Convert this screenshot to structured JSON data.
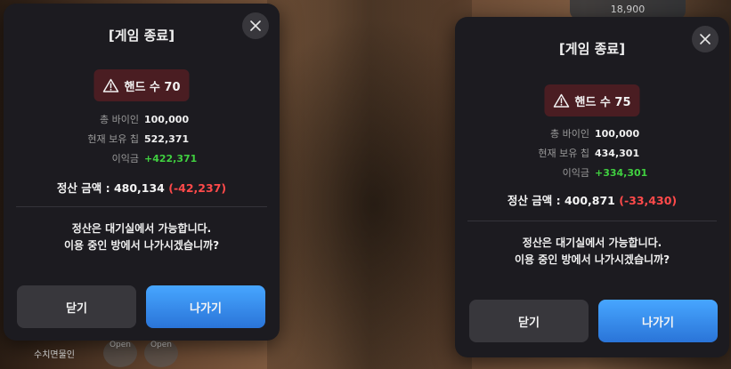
{
  "background": {
    "score": "18,900",
    "open_label": "Open",
    "player_name": "수치면물인"
  },
  "modals": [
    {
      "title": "[게임 종료]",
      "hands_label": "핸드 수 70",
      "stats": [
        {
          "label": "총 바이인",
          "value": "100,000"
        },
        {
          "label": "현재 보유 칩",
          "value": "522,371"
        },
        {
          "label": "이익금",
          "value": "+422,371"
        }
      ],
      "settle_label": "정산 금액 : 480,134",
      "settle_diff": "(-42,237)",
      "message_line1": "정산은 대기실에서 가능합니다.",
      "message_line2": "이용 중인 방에서 나가시겠습니까?",
      "close_label": "닫기",
      "exit_label": "나가기"
    },
    {
      "title": "[게임 종료]",
      "hands_label": "핸드 수 75",
      "stats": [
        {
          "label": "총 바이인",
          "value": "100,000"
        },
        {
          "label": "현재 보유 칩",
          "value": "434,301"
        },
        {
          "label": "이익금",
          "value": "+334,301"
        }
      ],
      "settle_label": "정산 금액 : 400,871",
      "settle_diff": "(-33,430)",
      "message_line1": "정산은 대기실에서 가능합니다.",
      "message_line2": "이용 중인 방에서 나가시겠습니까?",
      "close_label": "닫기",
      "exit_label": "나가기"
    }
  ],
  "colors": {
    "modal_bg": "#1c1b20",
    "badge_bg": "#4a1d22",
    "gain": "#40d040",
    "loss": "#ff4a4a",
    "primary_button": "#3a8ef0"
  }
}
